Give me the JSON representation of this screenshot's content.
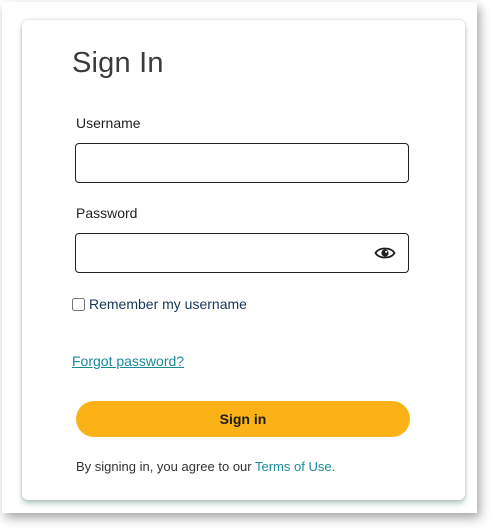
{
  "signin_form": {
    "title": "Sign In",
    "username": {
      "label": "Username",
      "value": "",
      "placeholder": ""
    },
    "password": {
      "label": "Password",
      "value": "",
      "placeholder": "",
      "toggle_icon": "eye-icon"
    },
    "remember": {
      "label": "Remember my username",
      "checked": false
    },
    "forgot_link": "Forgot password?",
    "submit_label": "Sign in",
    "agreement": {
      "prefix": "By signing in, you agree to our ",
      "terms_link": "Terms of Use."
    }
  },
  "colors": {
    "button_bg": "#fbb217",
    "link": "#1b8a9a",
    "label_navy": "#1a3556"
  }
}
